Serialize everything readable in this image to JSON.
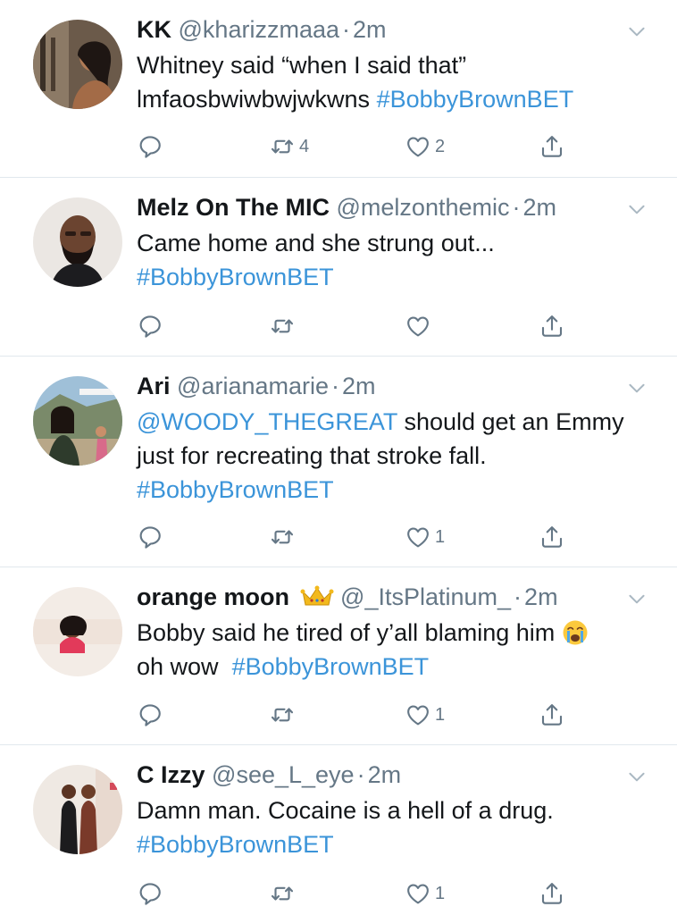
{
  "tweets": [
    {
      "name": "KK",
      "handle": "@kharizzmaaa",
      "time": "2m",
      "line1": "Whitney said “when I said that”",
      "line2_text": "lmfaosbwiwbwjwkwns ",
      "line2_hashtag": "#BobbyBrownBET",
      "retweets": "4",
      "likes": "2"
    },
    {
      "name": "Melz On The MIC",
      "handle": "@melzonthemic",
      "time": "2m",
      "line1": "Came home and she strung out...",
      "hashtag": "#BobbyBrownBET",
      "retweets": "",
      "likes": ""
    },
    {
      "name": "Ari",
      "handle": "@arianamarie",
      "time": "2m",
      "mention": "@WOODY_THEGREAT",
      "line1_rest": " should get an Emmy",
      "line2": "just for recreating that stroke fall.",
      "hashtag": "#BobbyBrownBET",
      "retweets": "",
      "likes": "1"
    },
    {
      "name": "orange moon",
      "crown": "crown-emoji",
      "handle": "@_ItsPlatinum_",
      "time": "2m",
      "line1": "Bobby said he tired of y’all blaming him",
      "emoji": "crying-face-emoji",
      "line2_text": "oh wow  ",
      "line2_hashtag": "#BobbyBrownBET",
      "retweets": "",
      "likes": "1"
    },
    {
      "name": "C Izzy",
      "handle": "@see_L_eye",
      "time": "2m",
      "line1": "Damn man. Cocaine is a hell of a drug.",
      "hashtag": "#BobbyBrownBET",
      "retweets": "",
      "likes": "1"
    }
  ],
  "colors": {
    "text": "#14171a",
    "secondary": "#657786",
    "link": "#3b94d9",
    "divider": "#e1e8ed"
  }
}
